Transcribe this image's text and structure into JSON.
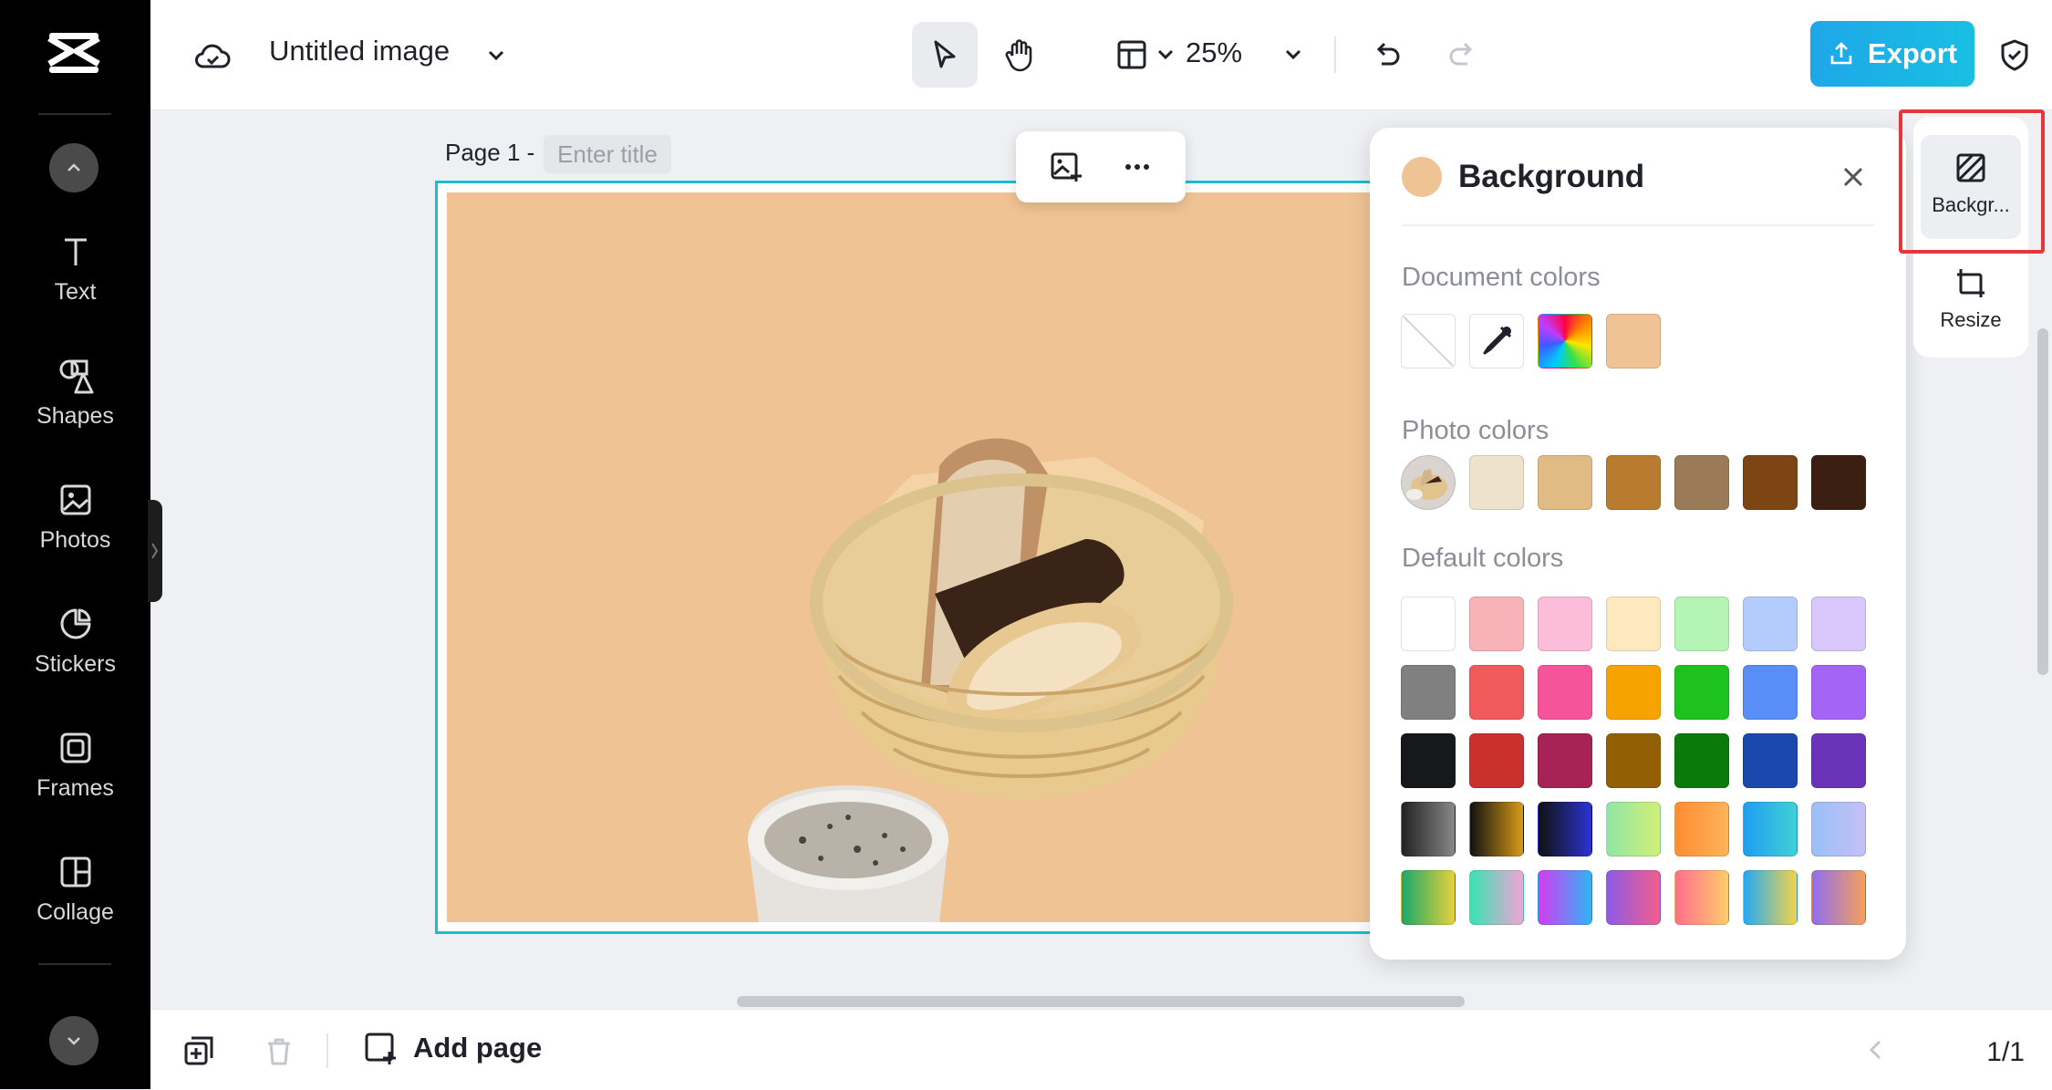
{
  "header": {
    "doc_title": "Untitled image",
    "zoom": "25%",
    "export_label": "Export"
  },
  "sidebar": {
    "items": [
      {
        "label": "Text",
        "icon": "text-icon"
      },
      {
        "label": "Shapes",
        "icon": "shapes-icon"
      },
      {
        "label": "Photos",
        "icon": "photos-icon"
      },
      {
        "label": "Stickers",
        "icon": "stickers-icon"
      },
      {
        "label": "Frames",
        "icon": "frames-icon"
      },
      {
        "label": "Collage",
        "icon": "collage-icon"
      }
    ]
  },
  "canvas": {
    "page_label": "Page 1 -",
    "title_placeholder": "Enter title",
    "background_color": "#efc394"
  },
  "bottom": {
    "add_page_label": "Add page",
    "page_count": "1/1"
  },
  "background_panel": {
    "title": "Background",
    "current_color": "#efc394",
    "document_colors_label": "Document colors",
    "photo_colors_label": "Photo colors",
    "default_colors_label": "Default colors",
    "document_colors": [
      "none",
      "eyedropper",
      "rainbow",
      "#efc394"
    ],
    "photo_colors": [
      "#efe2cc",
      "#e0bb83",
      "#b87b2f",
      "#9b7a58",
      "#7d4514",
      "#3b2012"
    ],
    "default_colors": [
      "#ffffff",
      "#f8b3b8",
      "#fbbdd9",
      "#fde9bd",
      "#b4f4b4",
      "#b4ccfb",
      "#d9c6fb",
      "#808080",
      "#f05a5a",
      "#f4559a",
      "#f6a300",
      "#1ec21e",
      "#5a8ef7",
      "#a465f6",
      "#17181b",
      "#c9302e",
      "#a82355",
      "#935f04",
      "#0a7a0a",
      "#1b48ad",
      "#6a34b8",
      "linear-gradient(90deg,#222,#888)",
      "linear-gradient(90deg,#111,#d89b19)",
      "linear-gradient(90deg,#111,#2b34d2)",
      "linear-gradient(90deg,#8fe6a6,#d3ef77)",
      "linear-gradient(90deg,#ff8c32,#fbb45a)",
      "linear-gradient(90deg,#1e9ff0,#41d0d5)",
      "linear-gradient(90deg,#98c1f7,#c6bff6)",
      "linear-gradient(90deg,#1aa86a,#e5d23b)",
      "linear-gradient(90deg,#39e3b2,#f3a2d6)",
      "linear-gradient(90deg,#d33cf2,#2fb5f4)",
      "linear-gradient(90deg,#8c5be6,#f35d8b)",
      "linear-gradient(90deg,#ff6f8b,#ffcc6c)",
      "linear-gradient(90deg,#23a9f5,#f4d34a)",
      "linear-gradient(90deg,#8f6ef0,#f5a05d)"
    ]
  },
  "right_rail": {
    "background_label": "Backgr...",
    "resize_label": "Resize"
  }
}
